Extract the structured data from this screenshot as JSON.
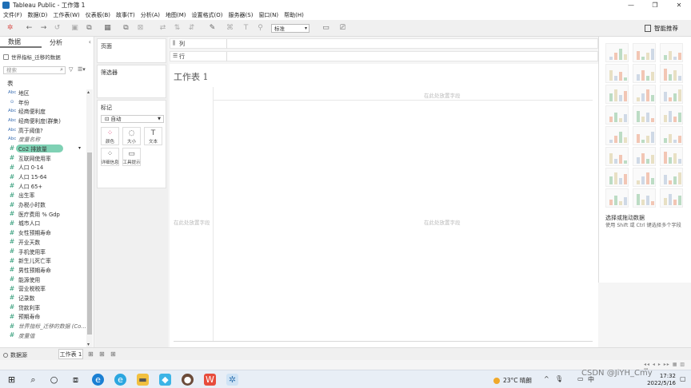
{
  "window": {
    "title": "Tableau Public - 工作簿 1",
    "minimize": "—",
    "maximize": "❐",
    "close": "✕"
  },
  "menu": [
    "文件(F)",
    "数据(D)",
    "工作表(W)",
    "仪表板(B)",
    "故事(T)",
    "分析(A)",
    "地图(M)",
    "设置格式(O)",
    "服务器(S)",
    "窗口(N)",
    "帮助(H)"
  ],
  "toolbar": {
    "fit": "标准",
    "show_me": "智能推荐"
  },
  "data_pane": {
    "tabs": [
      "数据",
      "分析"
    ],
    "datasource": "世界指标_迁移的数据",
    "search_placeholder": "搜索",
    "tables_label": "表",
    "fields": [
      {
        "type": "Abc",
        "name": "地区"
      },
      {
        "type": "⊙",
        "name": "年份"
      },
      {
        "type": "Abc",
        "name": "经商便利度"
      },
      {
        "type": "Abc",
        "name": "经商便利度(群集)"
      },
      {
        "type": "Abc",
        "name": "高于阈值?"
      },
      {
        "type": "Abc",
        "name": "度量名称"
      },
      {
        "type": "#",
        "name": "Co2 排放量"
      },
      {
        "type": "#",
        "name": "互联网使用率"
      },
      {
        "type": "#",
        "name": "人口 0-14"
      },
      {
        "type": "#",
        "name": "人口 15-64"
      },
      {
        "type": "#",
        "name": "人口 65+"
      },
      {
        "type": "#",
        "name": "出生率"
      },
      {
        "type": "#",
        "name": "办税小时数"
      },
      {
        "type": "#",
        "name": "医疗费用 % Gdp"
      },
      {
        "type": "#",
        "name": "城市人口"
      },
      {
        "type": "#",
        "name": "女性预期寿命"
      },
      {
        "type": "#",
        "name": "开业天数"
      },
      {
        "type": "#",
        "name": "手机使用率"
      },
      {
        "type": "#",
        "name": "新生儿死亡率"
      },
      {
        "type": "#",
        "name": "男性预期寿命"
      },
      {
        "type": "#",
        "name": "能源使用"
      },
      {
        "type": "#",
        "name": "营业税税率"
      },
      {
        "type": "#",
        "name": "记录数"
      },
      {
        "type": "#",
        "name": "贷款利率"
      },
      {
        "type": "#",
        "name": "预期寿命"
      },
      {
        "type": "#",
        "name": "世界指标_迁移的数据 (Co..."
      },
      {
        "type": "#",
        "name": "度量值"
      }
    ]
  },
  "cards": {
    "pages": "页面",
    "filters": "筛选器",
    "marks": "标记",
    "marks_type": "自动",
    "mark_buttons": [
      {
        "icon": "⁘",
        "label": "颜色"
      },
      {
        "icon": "◌",
        "label": "大小"
      },
      {
        "icon": "T",
        "label": "文本"
      },
      {
        "icon": "⁘",
        "label": "详细信息"
      },
      {
        "icon": "▭",
        "label": "工具提示"
      }
    ]
  },
  "shelves": {
    "columns": "列",
    "rows": "行"
  },
  "canvas": {
    "title": "工作表 1",
    "drop_field": "在此处放置字段"
  },
  "show_me": {
    "title": "选择或拖动数据",
    "description": "使用 Shift 或 Ctrl 键选择多个字段"
  },
  "sheet_tabs": {
    "datasource": "数据源",
    "sheet": "工作表 1"
  },
  "taskbar": {
    "weather": "23°C 晴朗",
    "ime": "中",
    "time": "17:32",
    "date": "2022/5/16"
  },
  "watermark": "CSDN @JiYH_Cmy",
  "colors": {
    "selected_field": "#7fd1b4",
    "measure": "#2e9a76",
    "dimension": "#3b6fb3"
  }
}
